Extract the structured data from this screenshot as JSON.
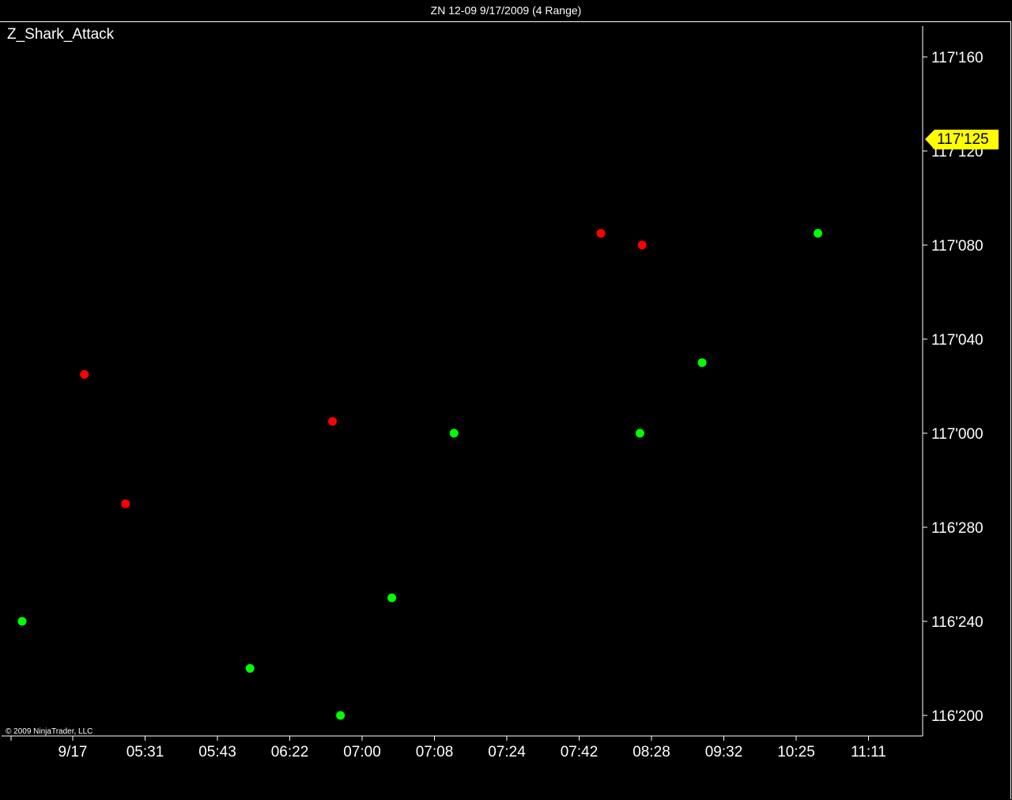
{
  "window": {
    "title": "ZN 12-09  9/17/2009 (4 Range)"
  },
  "indicator": {
    "name": "Z_Shark_Attack"
  },
  "footer": {
    "copyright": "© 2009 NinjaTrader, LLC"
  },
  "price_marker": {
    "label": "117'125",
    "value": 117.125,
    "color": "#ffff00"
  },
  "chart_data": {
    "type": "scatter",
    "title": "",
    "xlabel": "",
    "ylabel": "",
    "x_tick_labels": [
      "9/17",
      "05:31",
      "05:43",
      "06:22",
      "07:00",
      "07:08",
      "07:24",
      "07:42",
      "08:28",
      "09:32",
      "10:25",
      "11:11"
    ],
    "y_tick_labels": [
      "117'160",
      "117'120",
      "117'080",
      "117'040",
      "117'000",
      "116'280",
      "116'240",
      "116'200"
    ],
    "y_tick_values": [
      117.16,
      117.12,
      117.08,
      117.04,
      117.0,
      116.28,
      116.24,
      116.2
    ],
    "grid": false,
    "series": [
      {
        "color": "#00ff00",
        "points": [
          {
            "x": 0.0,
            "y": 116.24
          },
          {
            "x": 3.15,
            "y": 116.22
          },
          {
            "x": 4.4,
            "y": 116.2
          },
          {
            "x": 5.11,
            "y": 116.25
          },
          {
            "x": 5.97,
            "y": 117.0
          },
          {
            "x": 8.54,
            "y": 117.0
          },
          {
            "x": 9.4,
            "y": 117.03
          },
          {
            "x": 11.0,
            "y": 117.085
          }
        ]
      },
      {
        "color": "#ff0000",
        "points": [
          {
            "x": 0.86,
            "y": 117.025
          },
          {
            "x": 1.43,
            "y": 116.29
          },
          {
            "x": 4.29,
            "y": 117.005
          },
          {
            "x": 8.0,
            "y": 117.085
          },
          {
            "x": 8.57,
            "y": 117.08
          }
        ]
      }
    ]
  }
}
